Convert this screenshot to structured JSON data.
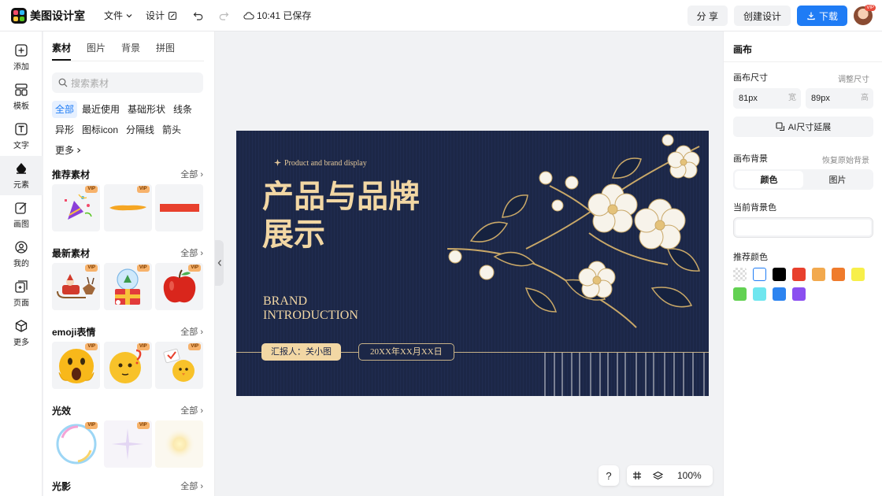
{
  "app": {
    "name": "美图设计室"
  },
  "topbar": {
    "menu_file": "文件",
    "menu_design": "设计",
    "save_status": "10:41 已保存",
    "share": "分 享",
    "create": "创建设计",
    "download": "下载",
    "avatar_badge": "VIP"
  },
  "rail": [
    {
      "label": "添加",
      "icon": "plus-icon"
    },
    {
      "label": "模板",
      "icon": "template-icon"
    },
    {
      "label": "文字",
      "icon": "text-icon"
    },
    {
      "label": "元素",
      "icon": "shapes-icon"
    },
    {
      "label": "画图",
      "icon": "draw-icon"
    },
    {
      "label": "我的",
      "icon": "user-icon"
    },
    {
      "label": "页面",
      "icon": "page-icon"
    },
    {
      "label": "更多",
      "icon": "cube-icon"
    }
  ],
  "panel": {
    "tabs": [
      "素材",
      "图片",
      "背景",
      "拼图"
    ],
    "search_placeholder": "搜索素材",
    "chips": [
      "全部",
      "最近使用",
      "基础形状",
      "线条",
      "异形",
      "图标icon",
      "分隔线",
      "箭头",
      "更多"
    ],
    "more_label": "全部",
    "vip": "VIP",
    "sections": [
      {
        "title": "推荐素材"
      },
      {
        "title": "最新素材"
      },
      {
        "title": "emoji表情"
      },
      {
        "title": "光效"
      },
      {
        "title": "光影"
      }
    ]
  },
  "canvas": {
    "subtitle": "Product and brand display",
    "title_line1": "产品与品牌",
    "title_line2": "展示",
    "en_line1": "BRAND",
    "en_line2": "INTRODUCTION",
    "reporter": "汇报人：关小图",
    "date": "20XX年XX月XX日"
  },
  "floating": {
    "help": "?",
    "zoom": "100%"
  },
  "right": {
    "title": "画布",
    "size_label": "画布尺寸",
    "resize_link": "调整尺寸",
    "width_value": "81px",
    "width_unit": "宽",
    "height_value": "89px",
    "height_unit": "高",
    "ai_extend": "AI尺寸延展",
    "bg_label": "画布背景",
    "restore_link": "恢复原始背景",
    "seg_color": "颜色",
    "seg_image": "图片",
    "current_bg_label": "当前背景色",
    "recommend_label": "推荐颜色",
    "swatches": [
      "transparent",
      "#ffffff",
      "#000000",
      "#e8402d",
      "#f2a94e",
      "#ef7b2c",
      "#f7ef4a",
      "#62d152",
      "#6fe6ef",
      "#2d84f0",
      "#8b4ff0"
    ]
  }
}
